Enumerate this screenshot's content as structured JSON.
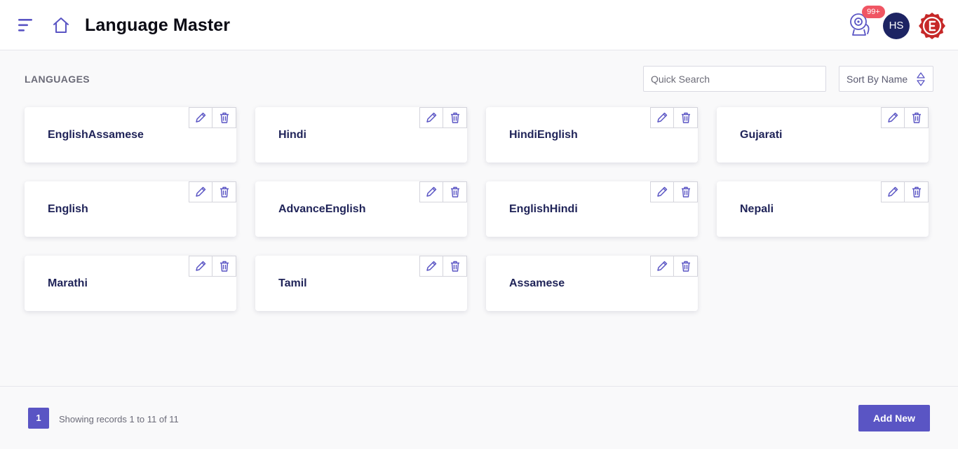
{
  "header": {
    "title": "Language Master",
    "notification_count": "99+",
    "avatar_initials": "HS"
  },
  "section": {
    "title": "LANGUAGES",
    "search_placeholder": "Quick Search",
    "sort_label": "Sort By Name"
  },
  "languages": [
    {
      "name": "EnglishAssamese"
    },
    {
      "name": "Hindi"
    },
    {
      "name": "HindiEnglish"
    },
    {
      "name": "Gujarati"
    },
    {
      "name": "English"
    },
    {
      "name": "AdvanceEnglish"
    },
    {
      "name": "EnglishHindi"
    },
    {
      "name": "Nepali"
    },
    {
      "name": "Marathi"
    },
    {
      "name": "Tamil"
    },
    {
      "name": "Assamese"
    }
  ],
  "footer": {
    "current_page": "1",
    "records_text": "Showing records 1 to 11 of 11",
    "add_label": "Add New"
  },
  "colors": {
    "accent": "#5a55c4",
    "title_text": "#1f2358",
    "badge": "#f05563",
    "avatar_bg": "#1d2463",
    "logo": "#c62828"
  },
  "icons": {
    "menu": "menu-icon",
    "home": "home-icon",
    "webcam": "webcam-icon",
    "edit": "pencil-icon",
    "delete": "trash-icon",
    "sort": "sort-arrows-icon"
  }
}
